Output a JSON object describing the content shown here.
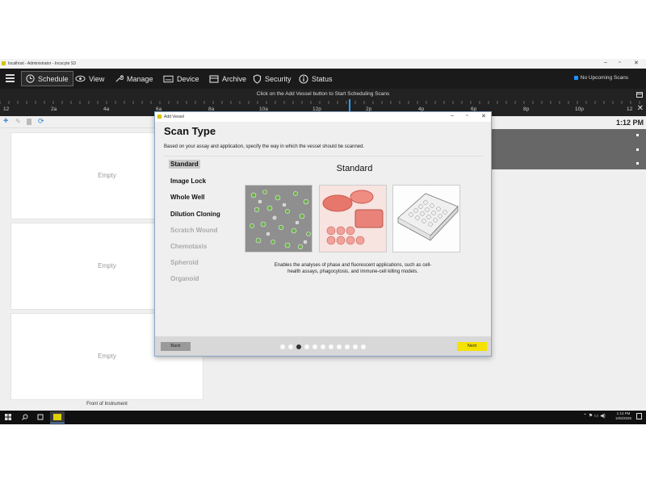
{
  "window": {
    "title": "localhost - Administrator - Incucyte S3"
  },
  "nav": {
    "items": [
      "Schedule",
      "View",
      "Manage",
      "Device",
      "Archive",
      "Security",
      "Status"
    ],
    "status": "No Upcoming Scans"
  },
  "timeline": {
    "message": "Click on the Add Vessel button to Start Scheduling Scans",
    "ticks": [
      "12",
      "2a",
      "4a",
      "6a",
      "8a",
      "10a",
      "12p",
      "2p",
      "4p",
      "6p",
      "8p",
      "10p",
      "12"
    ]
  },
  "left_panel": {
    "slots": [
      "Empty",
      "Empty",
      "Empty"
    ],
    "footer": "Front of Instrument"
  },
  "clock": "1:12 PM",
  "dialog": {
    "title": "Add Vessel",
    "heading": "Scan Type",
    "description": "Based on your assay and application, specify the way in which the vessel should be scanned.",
    "options": [
      {
        "label": "Standard",
        "state": "selected"
      },
      {
        "label": "Image Lock",
        "state": "enabled"
      },
      {
        "label": "Whole Well",
        "state": "enabled"
      },
      {
        "label": "Dilution Cloning",
        "state": "enabled"
      },
      {
        "label": "Scratch Wound",
        "state": "disabled"
      },
      {
        "label": "Chemotaxis",
        "state": "disabled"
      },
      {
        "label": "Spheroid",
        "state": "disabled"
      },
      {
        "label": "Organoid",
        "state": "disabled"
      }
    ],
    "selected_title": "Standard",
    "selected_description": "Enables the analyses of phase and fluorescent applications, such as cell-health assays, phagocytosis, and immune-cell killing models.",
    "back_label": "Back",
    "next_label": "Next",
    "wizard": {
      "total_steps": 11,
      "current_step": 3
    }
  },
  "taskbar": {
    "time": "1:13 PM",
    "date": "10/6/2025"
  },
  "colors": {
    "accent_yellow": "#f5e200",
    "timeline_now": "#2aa0ff",
    "status_blue": "#1e90ff"
  }
}
